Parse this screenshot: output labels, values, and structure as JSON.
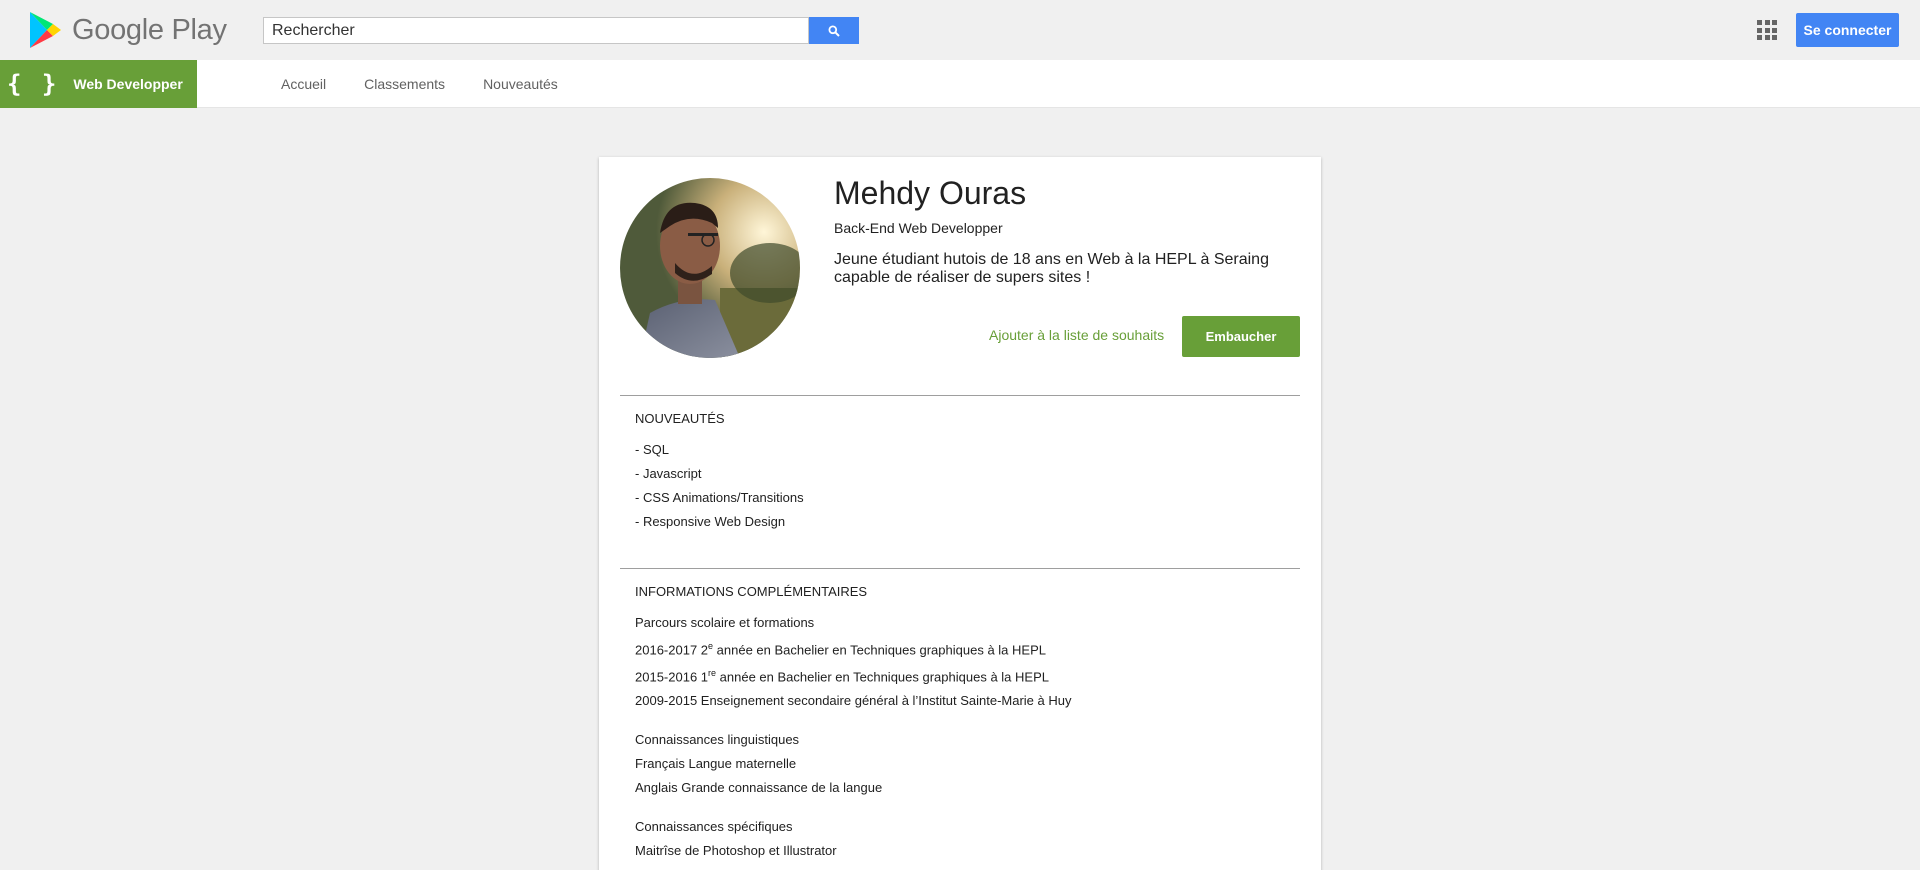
{
  "header": {
    "brand": "Google Play",
    "search_placeholder": "Rechercher",
    "signin_label": "Se connecter"
  },
  "nav": {
    "category_icon": "{ }",
    "category_label": "Web Developper",
    "links": [
      "Accueil",
      "Classements",
      "Nouveautés"
    ]
  },
  "profile": {
    "name": "Mehdy Ouras",
    "role": "Back-End Web Developper",
    "description": "Jeune étudiant hutois de 18 ans en Web à la HEPL à Seraing capable de réaliser de supers sites !",
    "wishlist_label": "Ajouter à la liste de souhaits",
    "hire_label": "Embaucher"
  },
  "news": {
    "title": "NOUVEAUTÉS",
    "items": [
      "- SQL",
      "- Javascript",
      "- CSS Animations/Transitions",
      "- Responsive Web Design"
    ]
  },
  "info": {
    "title": "INFORMATIONS COMPLÉMENTAIRES",
    "education_title": "Parcours scolaire et formations",
    "education": [
      {
        "pre": "2016-2017 2",
        "sup": "e",
        "post": " année en Bachelier en Techniques graphiques à la HEPL"
      },
      {
        "pre": "2015-2016 1",
        "sup": "re",
        "post": " année en Bachelier en Techniques graphiques à la HEPL"
      },
      {
        "pre": "2009-2015 Enseignement secondaire général à l’Institut Sainte-Marie à Huy",
        "sup": "",
        "post": ""
      }
    ],
    "languages_title": "Connaissances linguistiques",
    "languages": [
      "Français Langue maternelle",
      "Anglais Grande connaissance de la langue"
    ],
    "skills_title": "Connaissances spécifiques",
    "skills": [
      "Maitrîse de Photoshop et Illustrator"
    ]
  },
  "icons": {
    "logo": "google-play-logo",
    "search": "search-icon",
    "apps": "apps-grid-icon"
  },
  "colors": {
    "accent_green": "#689f38",
    "accent_blue": "#4285f4",
    "background": "#f0f0f0"
  }
}
